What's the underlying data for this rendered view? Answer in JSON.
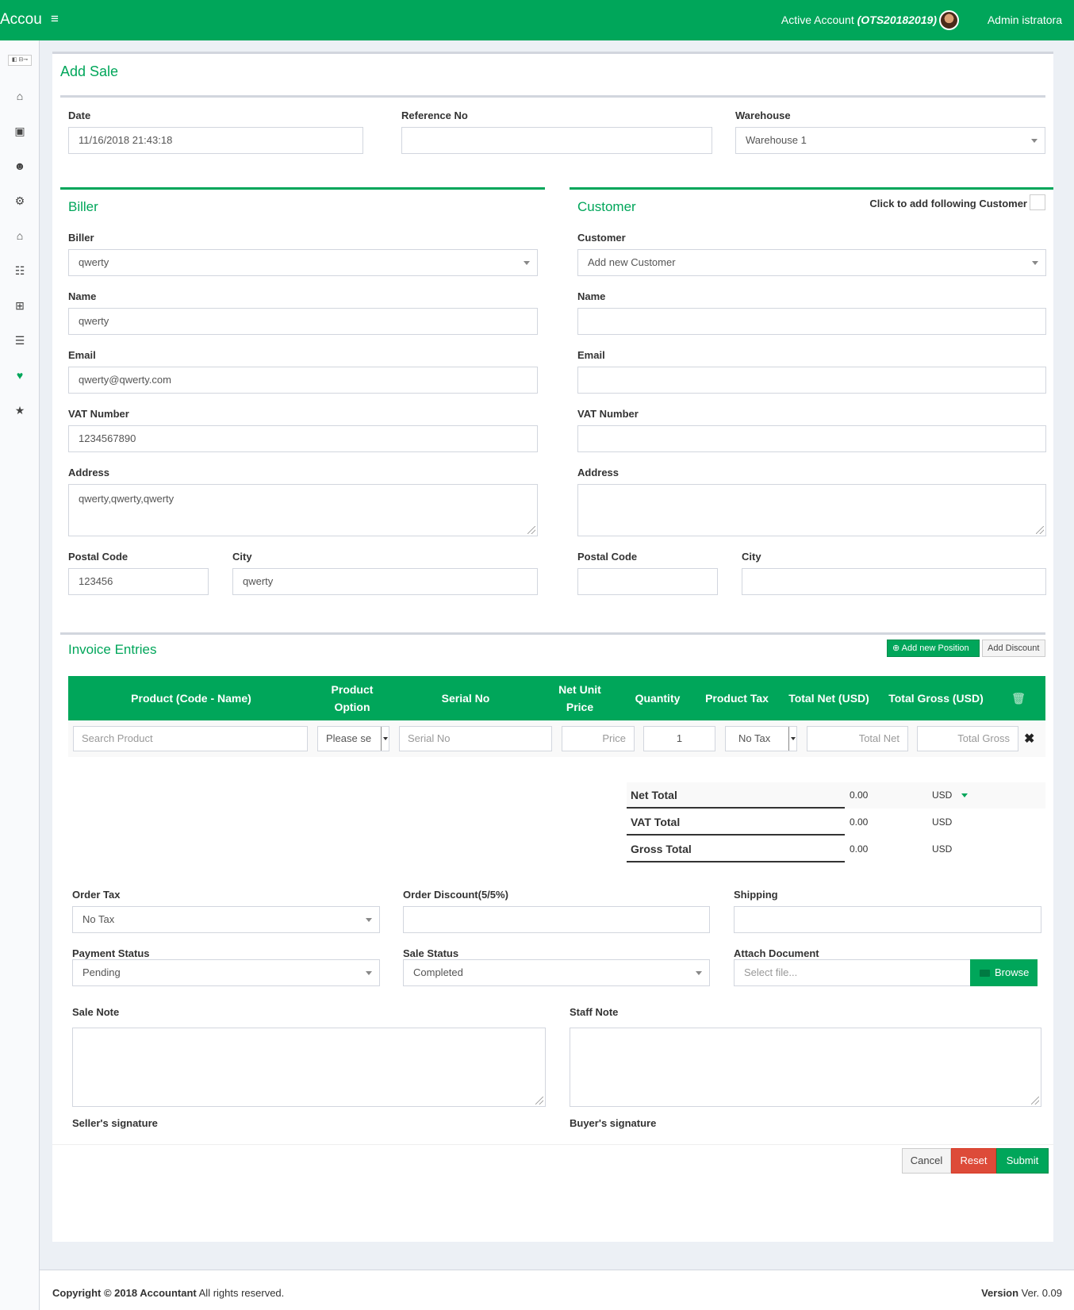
{
  "header": {
    "brand": "Accou",
    "active_account_label": "Active Account",
    "active_account_code": "(OTS20182019)",
    "user_name": "Admin istratora"
  },
  "sidebar": {
    "logo_text": "◧ ⊟⊸",
    "icons": [
      "home-icon",
      "address-book-icon",
      "users-icon",
      "cogs-icon",
      "home-icon",
      "sitemap-icon",
      "plus-square-icon",
      "barcode-icon",
      "heart-icon",
      "star-icon"
    ]
  },
  "page": {
    "title": "Add Sale"
  },
  "top_form": {
    "date_label": "Date",
    "date_value": "11/16/2018 21:43:18",
    "reference_label": "Reference No",
    "reference_value": "",
    "warehouse_label": "Warehouse",
    "warehouse_value": "Warehouse 1"
  },
  "biller": {
    "title": "Biller",
    "biller_label": "Biller",
    "biller_value": "qwerty",
    "name_label": "Name",
    "name_value": "qwerty",
    "email_label": "Email",
    "email_value": "qwerty@qwerty.com",
    "vat_label": "VAT Number",
    "vat_value": "1234567890",
    "address_label": "Address",
    "address_value": "qwerty,qwerty,qwerty",
    "postal_label": "Postal Code",
    "postal_value": "123456",
    "city_label": "City",
    "city_value": "qwerty"
  },
  "customer": {
    "title": "Customer",
    "add_following_label": "Click to add following Customer",
    "customer_label": "Customer",
    "customer_value": "Add new Customer",
    "name_label": "Name",
    "email_label": "Email",
    "vat_label": "VAT Number",
    "address_label": "Address",
    "postal_label": "Postal Code",
    "city_label": "City"
  },
  "invoice": {
    "title": "Invoice Entries",
    "add_position_label": "Add new Position",
    "add_discount_label": "Add Discount",
    "columns": [
      "Product (Code - Name)",
      "Product Option",
      "Serial No",
      "Net Unit Price",
      "Quantity",
      "Product Tax",
      "Total Net (USD)",
      "Total Gross (USD)"
    ],
    "row": {
      "product_placeholder": "Search Product",
      "option_value": "Please se",
      "serial_placeholder": "Serial No",
      "price_placeholder": "Price",
      "quantity_value": "1",
      "tax_value": "No Tax",
      "total_net_placeholder": "Total Net",
      "total_gross_placeholder": "Total Gross"
    }
  },
  "totals": {
    "net_label": "Net Total",
    "net_value": "0.00",
    "net_currency": "USD",
    "vat_label": "VAT Total",
    "vat_value": "0.00",
    "vat_currency": "USD",
    "gross_label": "Gross Total",
    "gross_value": "0.00",
    "gross_currency": "USD"
  },
  "order": {
    "tax_label": "Order Tax",
    "tax_value": "No Tax",
    "discount_label": "Order Discount(5/5%)",
    "shipping_label": "Shipping",
    "payment_status_label": "Payment Status",
    "payment_status_value": "Pending",
    "sale_status_label": "Sale Status",
    "sale_status_value": "Completed",
    "attach_label": "Attach Document",
    "attach_placeholder": "Select file...",
    "browse_label": "Browse",
    "sale_note_label": "Sale Note",
    "staff_note_label": "Staff Note",
    "seller_sig_label": "Seller's signature",
    "buyer_sig_label": "Buyer's signature"
  },
  "actions": {
    "cancel": "Cancel",
    "reset": "Reset",
    "submit": "Submit"
  },
  "footer": {
    "copyright_bold": "Copyright © 2018 Accountant",
    "copyright_rest": " All rights reserved.",
    "version_bold": "Version",
    "version_value": " Ver. 0.09"
  },
  "colors": {
    "primary": "#00a65a",
    "danger": "#dd4b39",
    "background": "#ecf0f5"
  }
}
